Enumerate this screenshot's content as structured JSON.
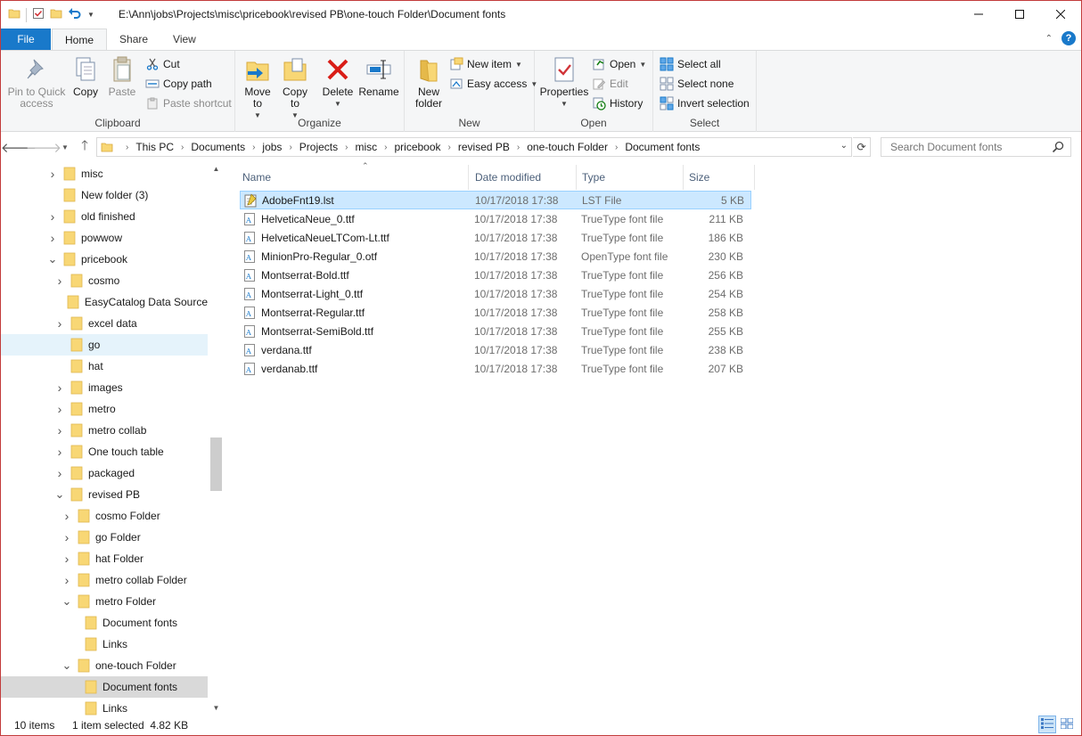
{
  "window": {
    "title": "E:\\Ann\\jobs\\Projects\\misc\\pricebook\\revised PB\\one-touch Folder\\Document fonts"
  },
  "ribbon_tabs": [
    {
      "label": "File"
    },
    {
      "label": "Home"
    },
    {
      "label": "Share"
    },
    {
      "label": "View"
    }
  ],
  "ribbon": {
    "clipboard": {
      "label": "Clipboard",
      "pin_label": "Pin to Quick access",
      "copy_label": "Copy",
      "paste_label": "Paste",
      "cut_label": "Cut",
      "copy_path_label": "Copy path",
      "paste_shortcut_label": "Paste shortcut"
    },
    "organize": {
      "label": "Organize",
      "move_to_label": "Move to",
      "copy_to_label": "Copy to",
      "delete_label": "Delete",
      "rename_label": "Rename"
    },
    "new": {
      "label": "New",
      "new_folder_label": "New folder",
      "new_item_label": "New item",
      "easy_access_label": "Easy access"
    },
    "open": {
      "label": "Open",
      "properties_label": "Properties",
      "open_label": "Open",
      "edit_label": "Edit",
      "history_label": "History"
    },
    "select": {
      "label": "Select",
      "select_all_label": "Select all",
      "select_none_label": "Select none",
      "invert_label": "Invert selection"
    }
  },
  "address": {
    "crumbs": [
      "This PC",
      "Documents",
      "jobs",
      "Projects",
      "misc",
      "pricebook",
      "revised PB",
      "one-touch Folder",
      "Document fonts"
    ],
    "search_placeholder": "Search Document fonts"
  },
  "nav_tree": [
    {
      "label": "misc",
      "level": 0,
      "expander": "collapsed"
    },
    {
      "label": "New folder (3)",
      "level": 0,
      "expander": "none"
    },
    {
      "label": "old finished",
      "level": 0,
      "expander": "collapsed"
    },
    {
      "label": "powwow",
      "level": 0,
      "expander": "collapsed"
    },
    {
      "label": "pricebook",
      "level": 0,
      "expander": "expanded"
    },
    {
      "label": "cosmo",
      "level": 1,
      "expander": "collapsed"
    },
    {
      "label": "EasyCatalog Data Source",
      "level": 1,
      "expander": "none"
    },
    {
      "label": "excel data",
      "level": 1,
      "expander": "collapsed"
    },
    {
      "label": "go",
      "level": 1,
      "expander": "none",
      "state": "hover"
    },
    {
      "label": "hat",
      "level": 1,
      "expander": "none"
    },
    {
      "label": "images",
      "level": 1,
      "expander": "collapsed"
    },
    {
      "label": "metro",
      "level": 1,
      "expander": "collapsed"
    },
    {
      "label": "metro collab",
      "level": 1,
      "expander": "collapsed"
    },
    {
      "label": "One touch table",
      "level": 1,
      "expander": "collapsed"
    },
    {
      "label": "packaged",
      "level": 1,
      "expander": "collapsed"
    },
    {
      "label": "revised PB",
      "level": 1,
      "expander": "expanded"
    },
    {
      "label": "cosmo Folder",
      "level": 2,
      "expander": "collapsed"
    },
    {
      "label": "go Folder",
      "level": 2,
      "expander": "collapsed"
    },
    {
      "label": "hat Folder",
      "level": 2,
      "expander": "collapsed"
    },
    {
      "label": "metro collab Folder",
      "level": 2,
      "expander": "collapsed"
    },
    {
      "label": "metro Folder",
      "level": 2,
      "expander": "expanded"
    },
    {
      "label": "Document fonts",
      "level": 3,
      "expander": "none"
    },
    {
      "label": "Links",
      "level": 3,
      "expander": "none"
    },
    {
      "label": "one-touch Folder",
      "level": 2,
      "expander": "expanded"
    },
    {
      "label": "Document fonts",
      "level": 3,
      "expander": "none",
      "state": "selected"
    },
    {
      "label": "Links",
      "level": 3,
      "expander": "none"
    }
  ],
  "columns": {
    "name": "Name",
    "date": "Date modified",
    "type": "Type",
    "size": "Size"
  },
  "files": [
    {
      "name": "AdobeFnt19.lst",
      "date": "10/17/2018 17:38",
      "type": "LST File",
      "size": "5 KB",
      "icon": "lst-file-icon",
      "selected": true
    },
    {
      "name": "HelveticaNeue_0.ttf",
      "date": "10/17/2018 17:38",
      "type": "TrueType font file",
      "size": "211 KB",
      "icon": "font-file-icon"
    },
    {
      "name": "HelveticaNeueLTCom-Lt.ttf",
      "date": "10/17/2018 17:38",
      "type": "TrueType font file",
      "size": "186 KB",
      "icon": "font-file-icon"
    },
    {
      "name": "MinionPro-Regular_0.otf",
      "date": "10/17/2018 17:38",
      "type": "OpenType font file",
      "size": "230 KB",
      "icon": "font-file-icon"
    },
    {
      "name": "Montserrat-Bold.ttf",
      "date": "10/17/2018 17:38",
      "type": "TrueType font file",
      "size": "256 KB",
      "icon": "font-file-icon"
    },
    {
      "name": "Montserrat-Light_0.ttf",
      "date": "10/17/2018 17:38",
      "type": "TrueType font file",
      "size": "254 KB",
      "icon": "font-file-icon"
    },
    {
      "name": "Montserrat-Regular.ttf",
      "date": "10/17/2018 17:38",
      "type": "TrueType font file",
      "size": "258 KB",
      "icon": "font-file-icon"
    },
    {
      "name": "Montserrat-SemiBold.ttf",
      "date": "10/17/2018 17:38",
      "type": "TrueType font file",
      "size": "255 KB",
      "icon": "font-file-icon"
    },
    {
      "name": "verdana.ttf",
      "date": "10/17/2018 17:38",
      "type": "TrueType font file",
      "size": "238 KB",
      "icon": "font-file-icon"
    },
    {
      "name": "verdanab.ttf",
      "date": "10/17/2018 17:38",
      "type": "TrueType font file",
      "size": "207 KB",
      "icon": "font-file-icon"
    }
  ],
  "status": {
    "items": "10 items",
    "selection": "1 item selected  4.82 KB"
  },
  "colors": {
    "accent": "#1979ca",
    "folder": "#f8d775",
    "selection": "#cce8ff"
  }
}
